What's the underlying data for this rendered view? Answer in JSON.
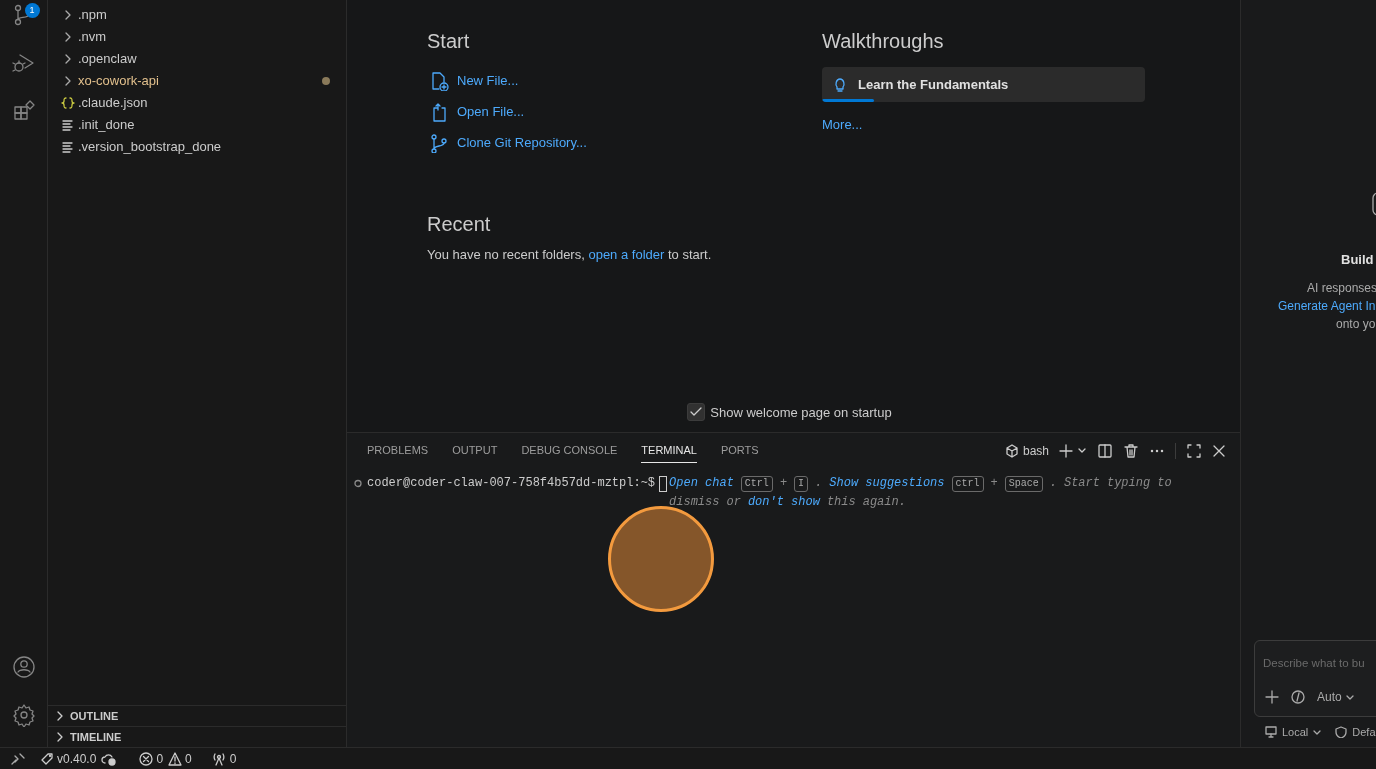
{
  "activity_bar": {
    "top": [
      {
        "kind": "source-control",
        "badge": "1"
      },
      {
        "kind": "run-debug"
      },
      {
        "kind": "extensions"
      }
    ],
    "bottom": [
      {
        "kind": "account"
      },
      {
        "kind": "settings"
      }
    ]
  },
  "explorer": {
    "items": [
      {
        "name": ".npm",
        "kind": "folder",
        "modified": false
      },
      {
        "name": ".nvm",
        "kind": "folder",
        "modified": false
      },
      {
        "name": ".openclaw",
        "kind": "folder",
        "modified": false
      },
      {
        "name": "xo-cowork-api",
        "kind": "folder",
        "modified": true
      },
      {
        "name": ".claude.json",
        "kind": "json",
        "modified": false
      },
      {
        "name": ".init_done",
        "kind": "text",
        "modified": false
      },
      {
        "name": ".version_bootstrap_done",
        "kind": "text",
        "modified": false
      }
    ],
    "sections": [
      {
        "label": "OUTLINE",
        "expanded": false
      },
      {
        "label": "TIMELINE",
        "expanded": false
      }
    ]
  },
  "welcome": {
    "start": {
      "title": "Start",
      "actions": [
        {
          "label": "New File...",
          "kind": "new-file"
        },
        {
          "label": "Open File...",
          "kind": "open-file"
        },
        {
          "label": "Clone Git Repository...",
          "kind": "clone"
        }
      ]
    },
    "recent": {
      "title": "Recent",
      "text_before": "You have no recent folders, ",
      "link": "open a folder",
      "text_after": " to start."
    },
    "walkthroughs": {
      "title": "Walkthroughs",
      "items": [
        {
          "label": "Learn the Fundamentals",
          "level": 0.16
        }
      ],
      "more": "More..."
    },
    "show_on_startup": {
      "label": "Show welcome page on startup",
      "checked": true
    }
  },
  "panel": {
    "tabs": [
      {
        "label": "PROBLEMS",
        "selected": false
      },
      {
        "label": "OUTPUT",
        "selected": false
      },
      {
        "label": "DEBUG CONSOLE",
        "selected": false
      },
      {
        "label": "TERMINAL",
        "selected": true
      },
      {
        "label": "PORTS",
        "selected": false
      }
    ],
    "terminal_name": "bash",
    "terminal": {
      "prompt": "coder@coder-claw-007-758f4b57dd-mztpl:~$",
      "hint": [
        {
          "kind": "link",
          "text": "Open chat"
        },
        {
          "kind": "key",
          "text": "Ctrl"
        },
        {
          "kind": "plain",
          "text": "+"
        },
        {
          "kind": "key",
          "text": "I"
        },
        {
          "kind": "plain",
          "text": "."
        },
        {
          "kind": "link",
          "text": "Show suggestions"
        },
        {
          "kind": "key",
          "text": "ctrl"
        },
        {
          "kind": "plain",
          "text": "+"
        },
        {
          "kind": "key",
          "text": "Space"
        },
        {
          "kind": "plain",
          "text": ". Start typing to dismiss or"
        },
        {
          "kind": "link",
          "text": "don't show"
        },
        {
          "kind": "plain",
          "text": "this again."
        }
      ]
    }
  },
  "chat": {
    "title": "Build",
    "lines": [
      {
        "kind": "plain",
        "text": "AI responses"
      },
      {
        "kind": "link",
        "text": "Generate Agent In"
      },
      {
        "kind": "plain",
        "text": "onto yo"
      }
    ],
    "input": {
      "placeholder": "Describe what to bu",
      "mode": "Auto"
    },
    "footer": [
      {
        "kind": "local",
        "label": "Local"
      },
      {
        "kind": "shield",
        "label": "Defa"
      }
    ]
  },
  "status_bar": {
    "version": "v0.40.0",
    "errors": "0",
    "warnings": "0",
    "ports": "0"
  }
}
